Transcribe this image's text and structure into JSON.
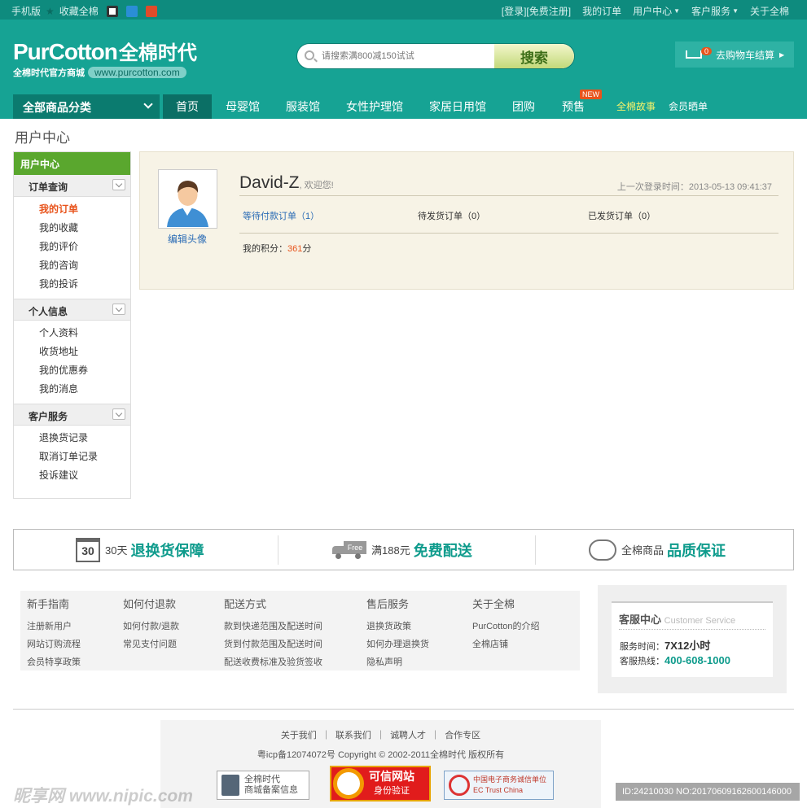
{
  "topbar": {
    "left": [
      "手机版",
      "收藏全棉"
    ],
    "right": [
      "[登录]",
      "[免费注册]",
      "我的订单",
      "用户中心",
      "客户服务",
      "关于全棉"
    ]
  },
  "logo": {
    "en": "PurCotton",
    "cn": "全棉时代",
    "sub": "全棉时代官方商城",
    "url": "www.purcotton.com"
  },
  "search": {
    "placeholder": "请搜索满800减150试试",
    "button": "搜索"
  },
  "cart": {
    "count": "0",
    "label": "去购物车结算"
  },
  "nav": {
    "all": "全部商品分类",
    "items": [
      "首页",
      "母婴馆",
      "服装馆",
      "女性护理馆",
      "家居日用馆",
      "团购",
      "预售",
      "全棉故事",
      "会员晒单"
    ],
    "new_badge": "NEW"
  },
  "page_title": "用户中心",
  "sidebar": {
    "head": "用户中心",
    "groups": [
      {
        "title": "订单查询",
        "items": [
          "我的订单",
          "我的收藏",
          "我的评价",
          "我的咨询",
          "我的投诉"
        ]
      },
      {
        "title": "个人信息",
        "items": [
          "个人资料",
          "收货地址",
          "我的优惠券",
          "我的消息"
        ]
      },
      {
        "title": "客户服务",
        "items": [
          "退换货记录",
          "取消订单记录",
          "投诉建议"
        ]
      }
    ]
  },
  "user": {
    "name": "David-Z",
    "welcome": ", 欢迎您!",
    "edit_avatar": "编辑头像",
    "last_login": "上一次登录时间：2013-05-13 09:41:37",
    "orders": [
      "等待付款订单（1）",
      "待发货订单（0）",
      "已发货订单（0）"
    ],
    "points_label": "我的积分：",
    "points": "361",
    "points_unit": "分"
  },
  "guarantee": [
    {
      "num": "30",
      "small": "30天",
      "big": "退换货保障"
    },
    {
      "tag": "Free",
      "small": "满188元",
      "big": "免费配送"
    },
    {
      "small": "全棉商品",
      "big": "品质保证"
    }
  ],
  "footer_links": [
    {
      "title": "新手指南",
      "items": [
        "注册新用户",
        "网站订购流程",
        "会员特享政策"
      ]
    },
    {
      "title": "如何付退款",
      "items": [
        "如何付款/退款",
        "常见支付问题"
      ]
    },
    {
      "title": "配送方式",
      "items": [
        "款到快递范围及配送时间",
        "货到付款范围及配送时间",
        "配送收费标准及验货签收"
      ]
    },
    {
      "title": "售后服务",
      "items": [
        "退换货政策",
        "如何办理退换货",
        "隐私声明"
      ]
    },
    {
      "title": "关于全棉",
      "items": [
        "PurCotton的介绍",
        "全棉店铺"
      ]
    }
  ],
  "service": {
    "title": "客服中心",
    "title_en": "Customer Service",
    "hours_label": "服务时间：",
    "hours": "7X12小时",
    "tel_label": "客服热线：",
    "tel": "400-608-1000"
  },
  "footer": {
    "links": [
      "关于我们",
      "联系我们",
      "诚聘人才",
      "合作专区"
    ],
    "copyright": "粤icp备12074072号 Copyright © 2002-2011全棉时代 版权所有",
    "badges": [
      "全棉时代",
      "商城备案信息",
      "可信网站",
      "身份验证",
      "中国电子商务诚信单位",
      "EC Trust China"
    ]
  },
  "watermark": {
    "left": "昵享网 www.nipic.com",
    "right": "ID:24210030 NO:20170609162600146000"
  },
  "colors": {
    "primary": "#16a394",
    "dark": "#0b7b6f",
    "accent": "#e8541c",
    "green": "#5aa72e"
  }
}
